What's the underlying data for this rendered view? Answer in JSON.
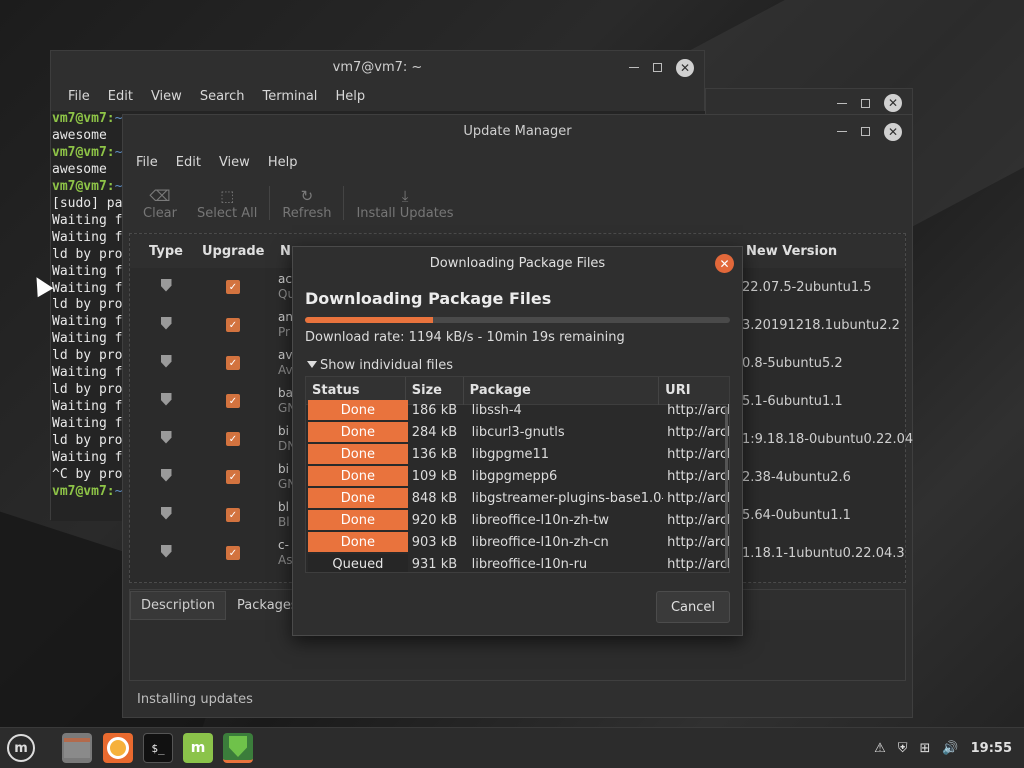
{
  "terminal": {
    "title": "vm7@vm7: ~",
    "menu": [
      "File",
      "Edit",
      "View",
      "Search",
      "Terminal",
      "Help"
    ],
    "lines": [
      {
        "prompt": "vm7@vm7:",
        "rest": "~"
      },
      {
        "text": "awesome"
      },
      {
        "prompt": "vm7@vm7:",
        "rest": "~"
      },
      {
        "text": "awesome"
      },
      {
        "prompt": "vm7@vm7:",
        "rest": "~"
      },
      {
        "text": "[sudo] pa"
      },
      {
        "text": "Waiting f"
      },
      {
        "text": "Waiting f"
      },
      {
        "text": "ld by pro"
      },
      {
        "text": "Waiting f"
      },
      {
        "text": "Waiting f"
      },
      {
        "text": "ld by pro"
      },
      {
        "text": "Waiting f"
      },
      {
        "text": "Waiting f"
      },
      {
        "text": "ld by pro"
      },
      {
        "text": "Waiting f"
      },
      {
        "text": "ld by pro"
      },
      {
        "text": "Waiting f"
      },
      {
        "text": "Waiting f"
      },
      {
        "text": "ld by pro"
      },
      {
        "text": "Waiting f"
      },
      {
        "text": "^C by pro"
      },
      {
        "prompt": "vm7@vm7:",
        "rest": "~"
      }
    ]
  },
  "update_manager": {
    "title": "Update Manager",
    "menu": [
      "File",
      "Edit",
      "View",
      "Help"
    ],
    "toolbar": {
      "clear": "Clear",
      "select_all": "Select All",
      "refresh": "Refresh",
      "install": "Install Updates"
    },
    "columns": {
      "type": "Type",
      "upgrade": "Upgrade",
      "name": "N",
      "new_version": "New Version"
    },
    "rows": [
      {
        "name": "ac",
        "sub": "Qu",
        "version": "22.07.5-2ubuntu1.5"
      },
      {
        "name": "an",
        "sub": "Pr",
        "version": "3.20191218.1ubuntu2.2"
      },
      {
        "name": "av",
        "sub": "Av",
        "version": "0.8-5ubuntu5.2"
      },
      {
        "name": "ba",
        "sub": "GN",
        "version": "5.1-6ubuntu1.1"
      },
      {
        "name": "bi",
        "sub": "DN",
        "version": "1:9.18.18-0ubuntu0.22.04"
      },
      {
        "name": "bi",
        "sub": "GN",
        "version": "2.38-4ubuntu2.6"
      },
      {
        "name": "bl",
        "sub": "Bl",
        "version": "5.64-0ubuntu1.1"
      },
      {
        "name": "c-",
        "sub": "As",
        "version": "1.18.1-1ubuntu0.22.04.3"
      }
    ],
    "tabs": [
      "Description",
      "Packages"
    ],
    "status": "Installing updates"
  },
  "dialog": {
    "title": "Downloading Package Files",
    "heading": "Downloading Package Files",
    "progress": 0.3,
    "rate": "Download rate: 1194 kB/s - 10min 19s remaining",
    "expander": "Show individual files",
    "columns": {
      "status": "Status",
      "size": "Size",
      "package": "Package",
      "uri": "URI"
    },
    "files": [
      {
        "status": "Done",
        "size": "186 kB",
        "package": "libssh-4",
        "uri": "http://arch"
      },
      {
        "status": "Done",
        "size": "284 kB",
        "package": "libcurl3-gnutls",
        "uri": "http://arch"
      },
      {
        "status": "Done",
        "size": "136 kB",
        "package": "libgpgme11",
        "uri": "http://arch"
      },
      {
        "status": "Done",
        "size": "109 kB",
        "package": "libgpgmepp6",
        "uri": "http://arch"
      },
      {
        "status": "Done",
        "size": "848 kB",
        "package": "libgstreamer-plugins-base1.0-0",
        "uri": "http://arch"
      },
      {
        "status": "Done",
        "size": "920 kB",
        "package": "libreoffice-l10n-zh-tw",
        "uri": "http://arch"
      },
      {
        "status": "Done",
        "size": "903 kB",
        "package": "libreoffice-l10n-zh-cn",
        "uri": "http://arch"
      },
      {
        "status": "Queued",
        "size": "931 kB",
        "package": "libreoffice-l10n-ru",
        "uri": "http://arch"
      }
    ],
    "cancel": "Cancel"
  },
  "panel": {
    "clock": "19:55"
  },
  "colors": {
    "accent": "#e9733d",
    "check": "#d3733f",
    "prompt": "#8ec447"
  }
}
